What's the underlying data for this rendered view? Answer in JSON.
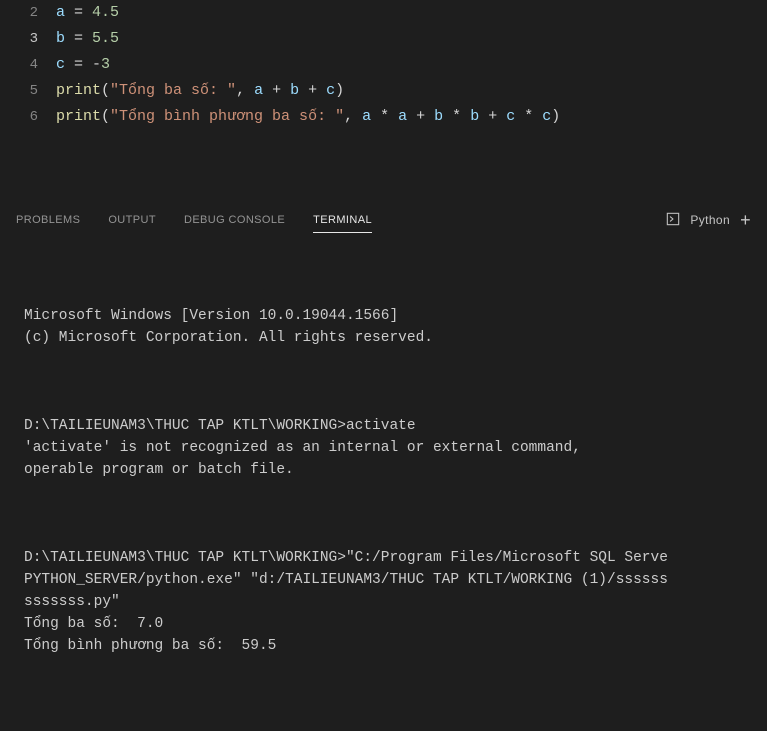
{
  "editor": {
    "lines": [
      {
        "num": "2",
        "tokens": [
          [
            "var",
            "a"
          ],
          [
            "op",
            " = "
          ],
          [
            "num",
            "4.5"
          ]
        ]
      },
      {
        "num": "3",
        "tokens": [
          [
            "var",
            "b"
          ],
          [
            "op",
            " = "
          ],
          [
            "num",
            "5.5"
          ]
        ],
        "current": true
      },
      {
        "num": "4",
        "tokens": [
          [
            "var",
            "c"
          ],
          [
            "op",
            " = "
          ],
          [
            "op",
            "-"
          ],
          [
            "num",
            "3"
          ]
        ]
      },
      {
        "num": "5",
        "tokens": [
          [
            "fn",
            "print"
          ],
          [
            "pun",
            "("
          ],
          [
            "str",
            "\"Tổng ba số: \""
          ],
          [
            "pun",
            ", "
          ],
          [
            "var",
            "a"
          ],
          [
            "op",
            " + "
          ],
          [
            "var",
            "b"
          ],
          [
            "op",
            " + "
          ],
          [
            "var",
            "c"
          ],
          [
            "pun",
            ")"
          ]
        ]
      },
      {
        "num": "6",
        "tokens": [
          [
            "fn",
            "print"
          ],
          [
            "pun",
            "("
          ],
          [
            "str",
            "\"Tổng bình phương ba số: \""
          ],
          [
            "pun",
            ", "
          ],
          [
            "var",
            "a"
          ],
          [
            "op",
            " * "
          ],
          [
            "var",
            "a"
          ],
          [
            "op",
            " + "
          ],
          [
            "var",
            "b"
          ],
          [
            "op",
            " * "
          ],
          [
            "var",
            "b"
          ],
          [
            "op",
            " + "
          ],
          [
            "var",
            "c"
          ],
          [
            "op",
            " * "
          ],
          [
            "var",
            "c"
          ],
          [
            "pun",
            ")"
          ]
        ]
      }
    ]
  },
  "panel": {
    "tabs": {
      "problems": "PROBLEMS",
      "output": "OUTPUT",
      "debug_console": "DEBUG CONSOLE",
      "terminal": "TERMINAL"
    },
    "shell_label": "Python",
    "plus": "+"
  },
  "terminal": {
    "block1": "Microsoft Windows [Version 10.0.19044.1566]\n(c) Microsoft Corporation. All rights reserved.",
    "block2": "D:\\TAILIEUNAM3\\THUC TAP KTLT\\WORKING>activate\n'activate' is not recognized as an internal or external command,\noperable program or batch file.",
    "block3": "D:\\TAILIEUNAM3\\THUC TAP KTLT\\WORKING>\"C:/Program Files/Microsoft SQL Serve\nPYTHON_SERVER/python.exe\" \"d:/TAILIEUNAM3/THUC TAP KTLT/WORKING (1)/ssssss\nsssssss.py\"\nTổng ba số:  7.0\nTổng bình phương ba số:  59.5"
  }
}
